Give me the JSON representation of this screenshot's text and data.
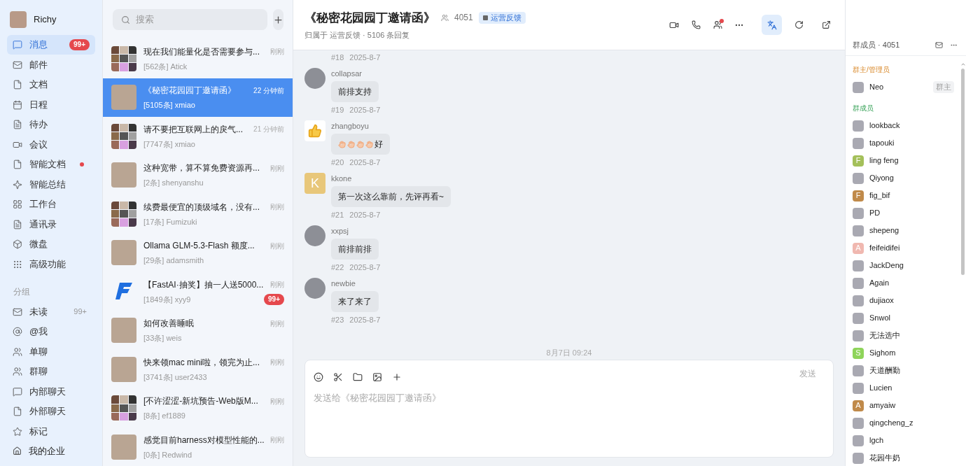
{
  "profile": {
    "name": "Richy"
  },
  "nav": [
    {
      "label": "消息",
      "selected": true,
      "badge": "99+"
    },
    {
      "label": "邮件",
      "selected": false
    },
    {
      "label": "文档",
      "selected": false
    },
    {
      "label": "日程",
      "selected": false
    },
    {
      "label": "待办",
      "selected": false
    },
    {
      "label": "会议",
      "selected": false
    },
    {
      "label": "智能文档",
      "selected": false,
      "dot": true
    },
    {
      "label": "智能总结",
      "selected": false
    },
    {
      "label": "工作台",
      "selected": false
    },
    {
      "label": "通讯录",
      "selected": false
    },
    {
      "label": "微盘",
      "selected": false
    },
    {
      "label": "高级功能",
      "selected": false
    }
  ],
  "groups_heading": "分组",
  "groups": [
    {
      "label": "未读",
      "selected": false,
      "count": "99+"
    },
    {
      "label": "@我",
      "selected": false
    },
    {
      "label": "单聊",
      "selected": false
    },
    {
      "label": "群聊",
      "selected": false
    },
    {
      "label": "内部聊天",
      "selected": false
    },
    {
      "label": "外部聊天",
      "selected": false
    },
    {
      "label": "标记",
      "selected": false
    }
  ],
  "enterprise": {
    "label": "我的企业"
  },
  "search": {
    "placeholder": "搜索"
  },
  "conversations": [
    {
      "title": "现在我们能量化是否需要参与...",
      "subtitle": "[562条] Atick",
      "time": "刚刚",
      "selected": false,
      "kind": "grid"
    },
    {
      "title": "《秘密花园园丁邀请函》",
      "subtitle": "[5105条] xmiao",
      "time": "22 分钟前",
      "selected": true,
      "kind": "photo"
    },
    {
      "title": "请不要把互联网上的戾气...",
      "subtitle": "[7747条] xmiao",
      "time": "21 分钟前",
      "selected": false,
      "kind": "grid"
    },
    {
      "title": "这种宽带，算不算免费资源再...",
      "subtitle": "[2条] shenyanshu",
      "time": "刚刚",
      "selected": false,
      "kind": "photo"
    },
    {
      "title": "续费最便宜的顶级域名，没有...",
      "subtitle": "[17条] Fumizuki",
      "time": "刚刚",
      "selected": false,
      "kind": "grid"
    },
    {
      "title": "Ollama GLM-5.3-Flash 额度...",
      "subtitle": "[29条] adamsmith",
      "time": "刚刚",
      "selected": false,
      "kind": "photo"
    },
    {
      "title": "【FastAI·抽奖】抽一人送5000...",
      "subtitle": "[1849条] xyy9",
      "time": "刚刚",
      "selected": false,
      "kind": "logo",
      "badge": "99+"
    },
    {
      "title": "如何改善睡眠",
      "subtitle": "[33条] weis",
      "time": "刚刚",
      "selected": false,
      "kind": "photo"
    },
    {
      "title": "快来领mac mini啦，领完为止...",
      "subtitle": "[3741条] user2433",
      "time": "刚刚",
      "selected": false,
      "kind": "photo"
    },
    {
      "title": "[不许涩涩-新坑预告-Web版M...",
      "subtitle": "[8条] ef1889",
      "time": "刚刚",
      "selected": false,
      "kind": "grid"
    },
    {
      "title": "感觉目前harness对模型性能的...",
      "subtitle": "[0条] Redwind",
      "time": "刚刚",
      "selected": false,
      "kind": "photo"
    }
  ],
  "chat": {
    "title": "《秘密花园园丁邀请函》",
    "member_count": "4051",
    "tag": "运营反馈",
    "subtitle": "归属于 运营反馈 · 5106 条回复",
    "call_alert": true,
    "translate_on": true
  },
  "previous_meta": {
    "number": "#18",
    "date": "2025-8-7"
  },
  "messages": [
    {
      "author": "collapsar",
      "text": "前排支持",
      "number": "#19",
      "date": "2025-8-7",
      "kind": "photo"
    },
    {
      "author": "zhangboyu",
      "text": "好",
      "number": "#20",
      "date": "2025-8-7",
      "kind": "thumb"
    },
    {
      "author": "kkone",
      "text": "第一次这么靠前，先评再看~",
      "number": "#21",
      "date": "2025-8-7",
      "kind": "letter",
      "letter": "K",
      "color": "#e8c77a"
    },
    {
      "author": "xxpsj",
      "text": "前排前排",
      "number": "#22",
      "date": "2025-8-7",
      "kind": "photo"
    },
    {
      "author": "newbie",
      "text": "来了来了",
      "number": "#23",
      "date": "2025-8-7",
      "kind": "photo"
    }
  ],
  "date_divider": "8月7日 09:24",
  "composer": {
    "placeholder": "发送给《秘密花园园丁邀请函》",
    "send": "发送",
    "send_disabled": true
  },
  "members_panel": {
    "title": "群成员 · 4051",
    "sections": [
      {
        "title": "群主/管理员",
        "kind": "admins",
        "members": [
          {
            "name": "Neo",
            "role": "群主",
            "kind": "photo"
          }
        ]
      },
      {
        "title": "群成员",
        "kind": "members",
        "members": [
          {
            "name": "lookback",
            "kind": "photo"
          },
          {
            "name": "tapouki",
            "kind": "photo"
          },
          {
            "name": "ling feng",
            "kind": "letter",
            "letter": "F",
            "color": "#a4c05a"
          },
          {
            "name": "Qiyong",
            "kind": "photo"
          },
          {
            "name": "fig_bif",
            "kind": "letter",
            "letter": "F",
            "color": "#c08a4a"
          },
          {
            "name": "PD",
            "kind": "photo"
          },
          {
            "name": "shepeng",
            "kind": "photo"
          },
          {
            "name": "feifeidifei",
            "kind": "letter",
            "letter": "A",
            "color": "#f0b8b0"
          },
          {
            "name": "JackDeng",
            "kind": "photo"
          },
          {
            "name": "Again",
            "kind": "photo"
          },
          {
            "name": "dujiaox",
            "kind": "photo"
          },
          {
            "name": "Snwol",
            "kind": "photo"
          },
          {
            "name": "无法选中",
            "kind": "photo"
          },
          {
            "name": "Sighom",
            "kind": "letter",
            "letter": "S",
            "color": "#8ed45a"
          },
          {
            "name": "天道酬勤",
            "kind": "photo"
          },
          {
            "name": "Lucien",
            "kind": "photo"
          },
          {
            "name": "amyaiw",
            "kind": "letter",
            "letter": "A",
            "color": "#c08a4a"
          },
          {
            "name": "qingcheng_z",
            "kind": "photo"
          },
          {
            "name": "lgch",
            "kind": "photo"
          },
          {
            "name": "花园牛奶",
            "kind": "photo"
          }
        ]
      }
    ]
  }
}
